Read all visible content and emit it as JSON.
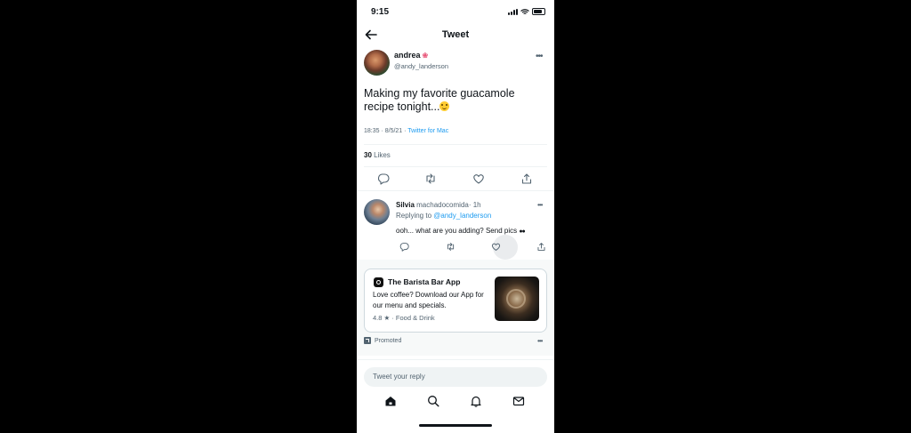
{
  "status_bar": {
    "time": "9:15"
  },
  "header": {
    "title": "Tweet"
  },
  "tweet": {
    "author_name": "andrea",
    "author_handle": "@andy_landerson",
    "text": "Making my favorite guacamole recipe tonight...",
    "timestamp": "18:35 · 8/5/21 · ",
    "source": "Twitter for Mac",
    "likes_count": "30",
    "likes_label": " Likes"
  },
  "reply": {
    "author_name": "Silvia",
    "author_handle": "machadocomida",
    "age": "· 1h",
    "replying_prefix": "Replying to ",
    "replying_handle": "@andy_landerson",
    "text": "ooh... what are you adding? Send pics"
  },
  "ad": {
    "app_name": "The Barista Bar App",
    "description": "Love coffee? Download our App for our menu and specials.",
    "rating": "4.8 ★ · Food & Drink",
    "promoted_label": "Promoted"
  },
  "compose": {
    "placeholder": "Tweet your reply"
  },
  "colors": {
    "accent": "#1d9bf0",
    "text": "#0f1419",
    "secondary": "#536471",
    "background": "#000000"
  },
  "icons": [
    "back-arrow-icon",
    "more-icon",
    "reply-icon",
    "retweet-icon",
    "like-icon",
    "share-icon",
    "home-icon",
    "search-icon",
    "notifications-icon",
    "messages-icon"
  ]
}
